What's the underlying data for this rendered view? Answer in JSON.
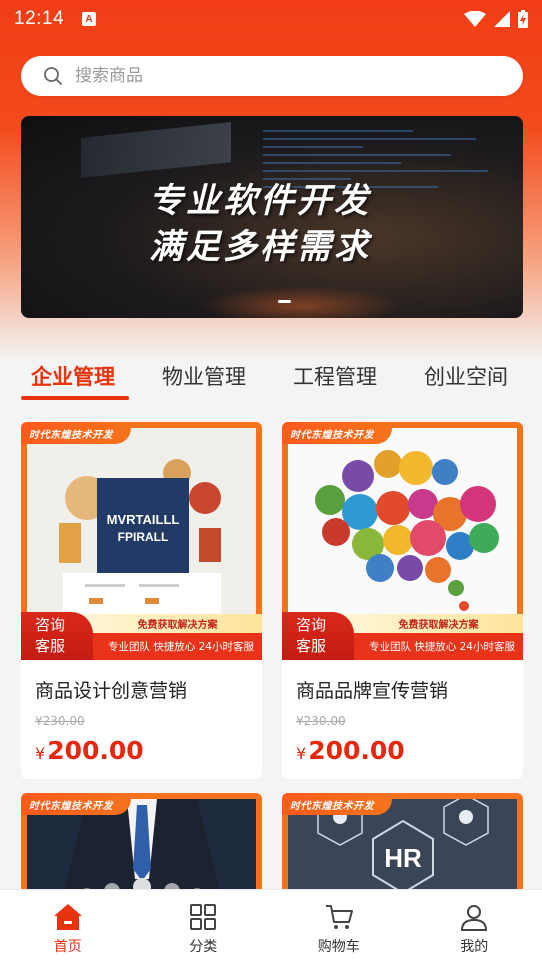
{
  "status_bar": {
    "time": "12:14",
    "app_icon_letter": "A"
  },
  "search": {
    "placeholder": "搜索商品"
  },
  "banner": {
    "line1": "专业软件开发",
    "line2": "满足多样需求"
  },
  "tabs": [
    {
      "label": "企业管理",
      "active": true
    },
    {
      "label": "物业管理",
      "active": false
    },
    {
      "label": "工程管理",
      "active": false
    },
    {
      "label": "创业空间",
      "active": false
    }
  ],
  "product_cards": [
    {
      "tag": "时代东煌技术开发",
      "consult_line1": "咨询",
      "consult_line2": "客服",
      "promo_top": "免费获取解决方案",
      "promo_bottom": "专业团队 快捷放心 24小时客服",
      "image_text_line1": "MVRTAILLL",
      "image_text_line2": "FPIRALL",
      "title": "商品设计创意营销",
      "old_price": "¥230.00",
      "price_symbol": "¥",
      "price": "200.00"
    },
    {
      "tag": "时代东煌技术开发",
      "consult_line1": "咨询",
      "consult_line2": "客服",
      "promo_top": "免费获取解决方案",
      "promo_bottom": "专业团队 快捷放心 24小时客服",
      "title": "商品品牌宣传营销",
      "old_price": "¥230.00",
      "price_symbol": "¥",
      "price": "200.00"
    },
    {
      "tag": "时代东煌技术开发"
    },
    {
      "tag": "时代东煌技术开发",
      "image_text": "HR"
    }
  ],
  "bottom_nav": [
    {
      "label": "首页",
      "icon": "home-icon",
      "active": true
    },
    {
      "label": "分类",
      "icon": "grid-icon",
      "active": false
    },
    {
      "label": "购物车",
      "icon": "cart-icon",
      "active": false
    },
    {
      "label": "我的",
      "icon": "user-icon",
      "active": false
    }
  ],
  "colors": {
    "brand": "#e8330f",
    "header_top": "#f23d16",
    "card_frame": "#f5731c",
    "price": "#e8270f"
  }
}
